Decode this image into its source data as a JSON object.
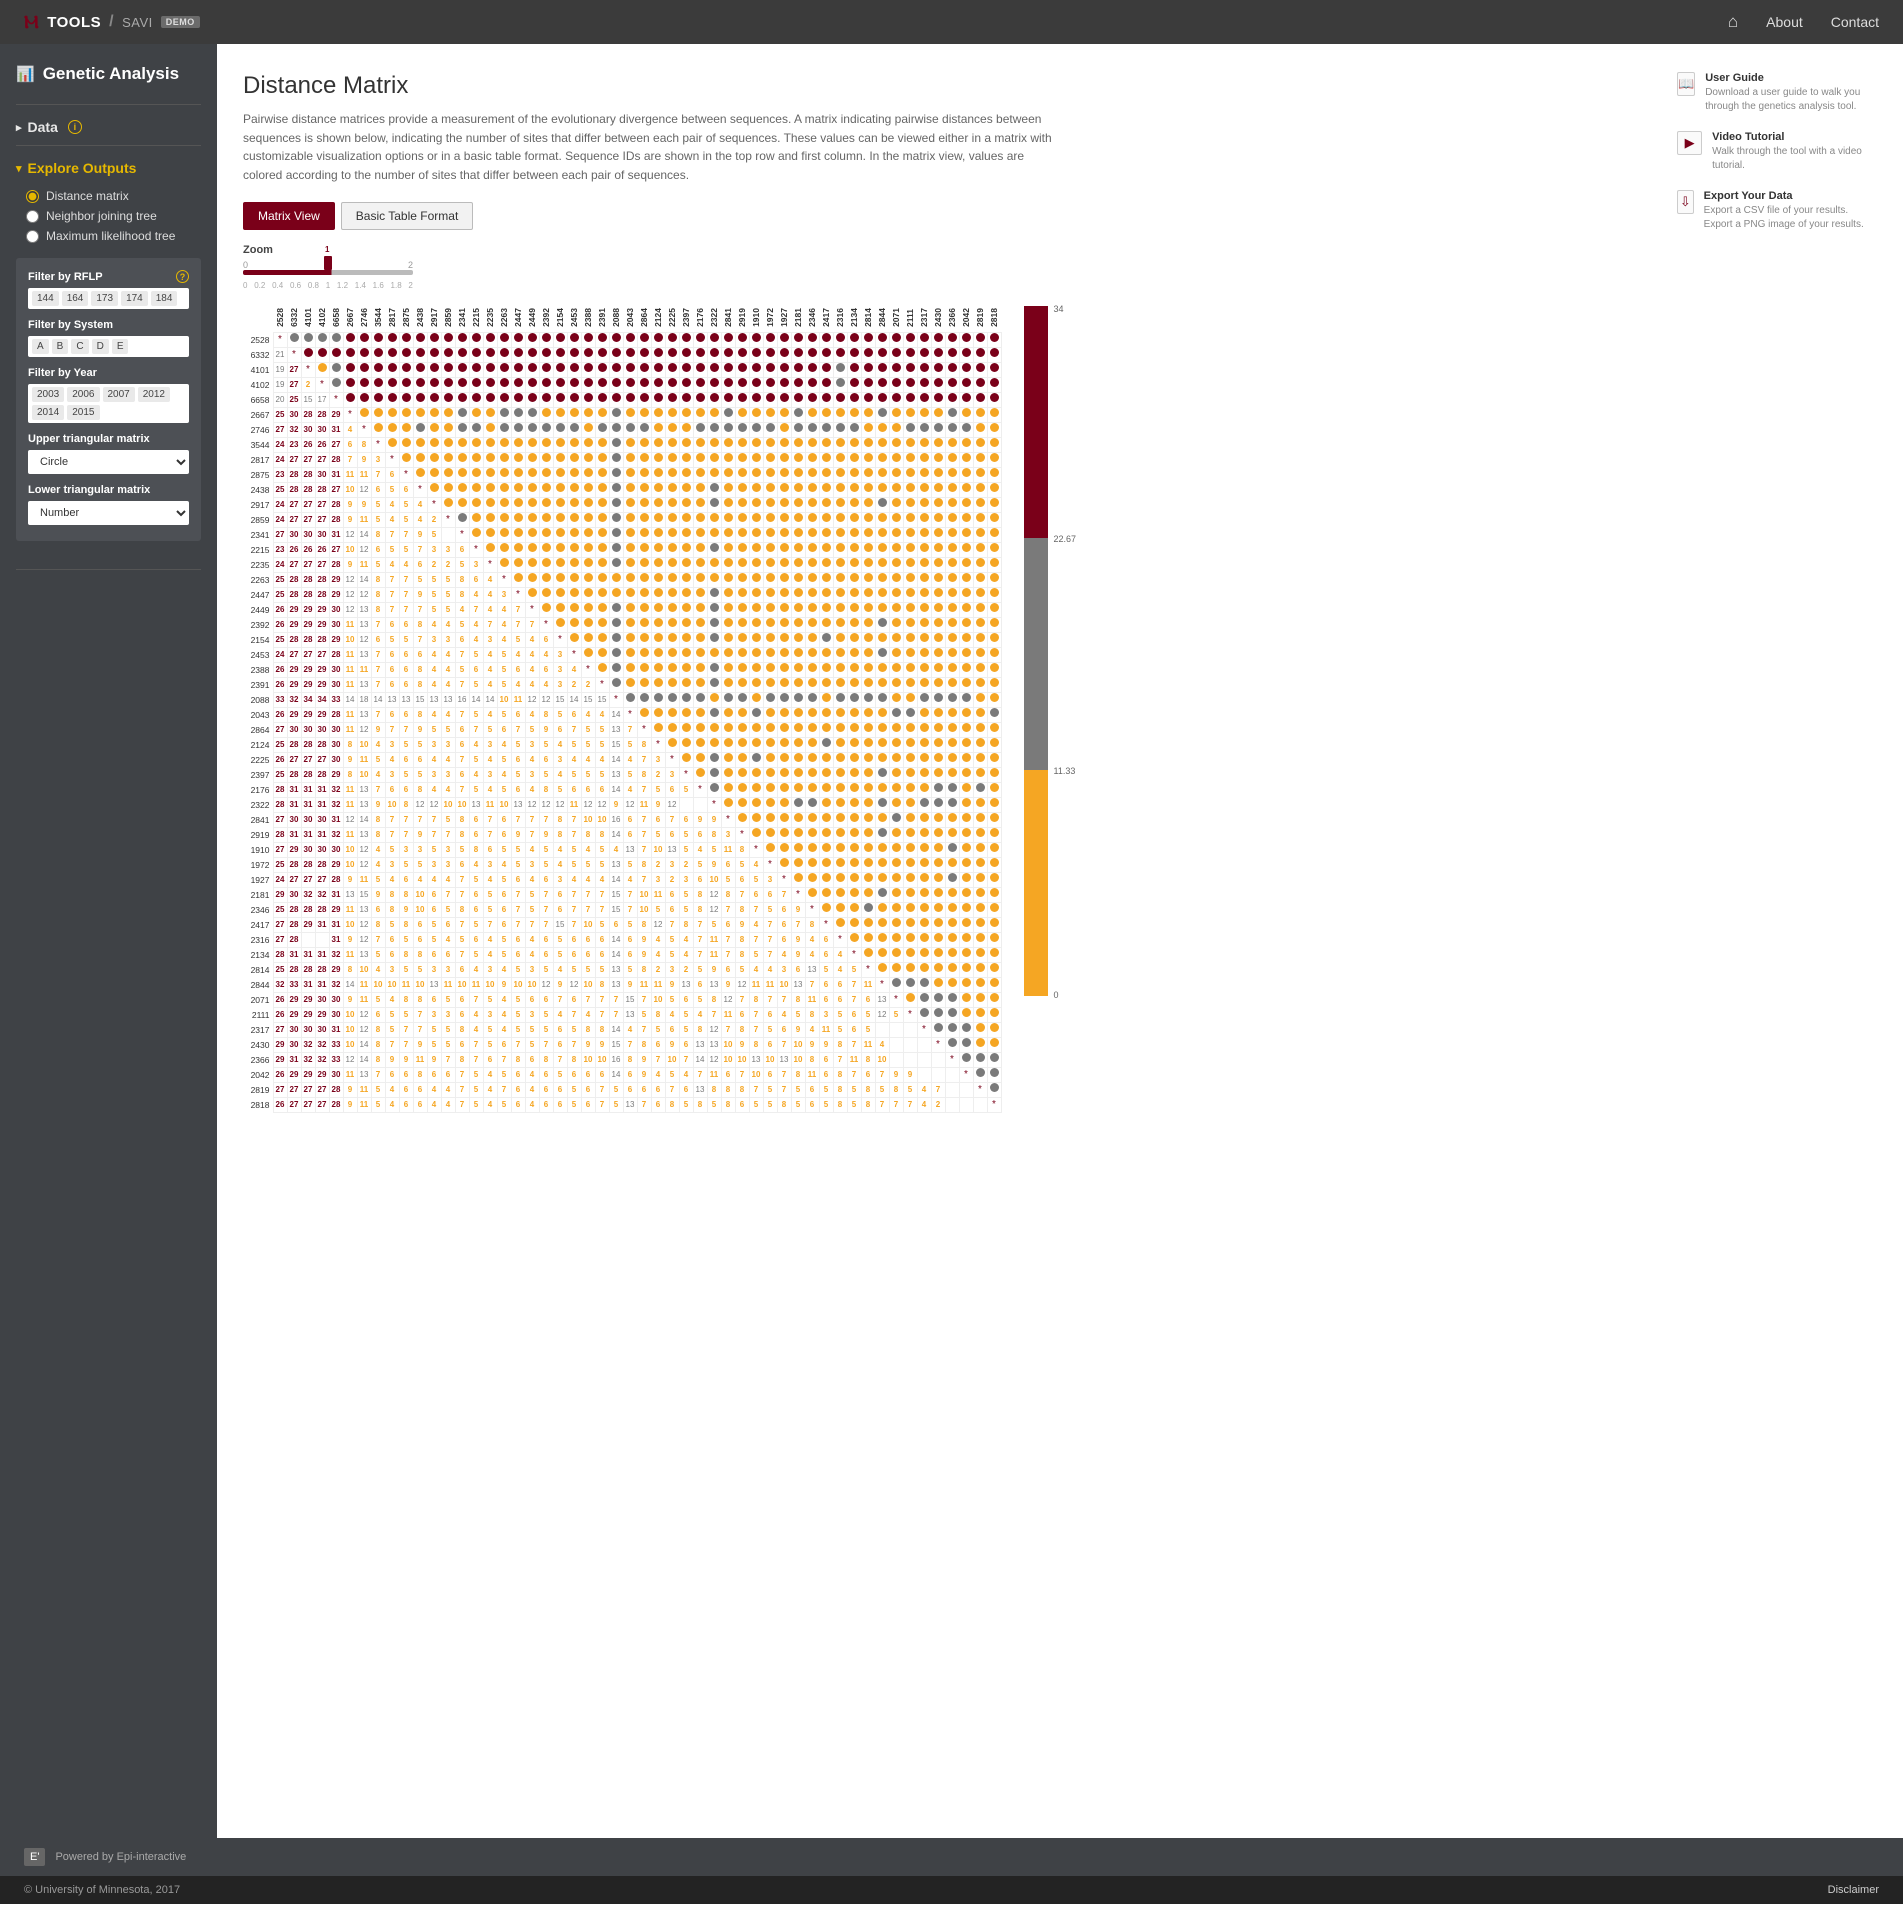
{
  "brand": {
    "tools": "TOOLS",
    "app": "SAVI",
    "badge": "DEMO"
  },
  "nav": {
    "about": "About",
    "contact": "Contact"
  },
  "sidebar": {
    "title": "Genetic Analysis",
    "data_label": "Data",
    "explore_label": "Explore Outputs",
    "items": [
      {
        "label": "Distance matrix",
        "checked": true
      },
      {
        "label": "Neighbor joining tree",
        "checked": false
      },
      {
        "label": "Maximum likelihood tree",
        "checked": false
      }
    ],
    "filters": {
      "rflp_label": "Filter by RFLP",
      "rflp_chips": [
        "144",
        "164",
        "173",
        "174",
        "184"
      ],
      "system_label": "Filter by System",
      "system_chips": [
        "A",
        "B",
        "C",
        "D",
        "E"
      ],
      "year_label": "Filter by Year",
      "year_chips": [
        "2003",
        "2006",
        "2007",
        "2012",
        "2014",
        "2015"
      ],
      "upper_label": "Upper triangular matrix",
      "upper_value": "Circle",
      "lower_label": "Lower triangular matrix",
      "lower_value": "Number"
    }
  },
  "page": {
    "title": "Distance Matrix",
    "intro": "Pairwise distance matrices provide a measurement of the evolutionary divergence between sequences. A matrix indicating pairwise distances between sequences is shown below, indicating the number of sites that differ between each pair of sequences. These values can be viewed either in a matrix with customizable visualization options or in a basic table format. Sequence IDs are shown in the top row and first column. In the matrix view, values are colored according to the number of sites that differ between each pair of sequences.",
    "tabs": [
      "Matrix View",
      "Basic Table Format"
    ],
    "zoom_label": "Zoom",
    "zoom_ends": [
      "0",
      "2"
    ],
    "zoom_scale": [
      "0",
      "0.2",
      "0.4",
      "0.6",
      "0.8",
      "1",
      "1.2",
      "1.4",
      "1.6",
      "1.8",
      "2"
    ],
    "zoom_value": "1"
  },
  "help": [
    {
      "icon": "📖",
      "title": "User Guide",
      "desc": "Download a user guide to walk you through the genetics analysis tool."
    },
    {
      "icon": "▶",
      "title": "Video Tutorial",
      "desc": "Walk through the tool with a video tutorial."
    },
    {
      "icon": "⇩",
      "title": "Export Your Data",
      "desc": "Export a CSV file of your results. Export a PNG image of your results."
    }
  ],
  "legend": {
    "ticks": [
      "34",
      "22.67",
      "11.33",
      "0"
    ]
  },
  "footer": {
    "powered": "Powered by Epi-interactive",
    "copy": "© University of Minnesota, 2017",
    "disc": "Disclaimer"
  },
  "chart_data": {
    "type": "heatmap",
    "title": "Distance Matrix",
    "ids": [
      "2528",
      "6332",
      "4101",
      "4102",
      "6658",
      "2667",
      "2746",
      "3544",
      "2817",
      "2875",
      "2438",
      "2917",
      "2859",
      "2341",
      "2215",
      "2235",
      "2263",
      "2447",
      "2449",
      "2392",
      "2154",
      "2453",
      "2388",
      "2391",
      "2088",
      "2043",
      "2864",
      "2124",
      "2225",
      "2397",
      "2176",
      "2322",
      "2841",
      "2919",
      "1910",
      "1972",
      "1927",
      "2181",
      "2346",
      "2417",
      "2316",
      "2134",
      "2814",
      "2844",
      "2071",
      "2111",
      "2317",
      "2430",
      "2366",
      "2042",
      "2819",
      "2818"
    ],
    "upper_viz": "circle",
    "lower_viz": "number",
    "legend_breaks": [
      0,
      11.33,
      22.67,
      34
    ],
    "colors": {
      "high": "#7a0019",
      "mid": "#7a7a7a",
      "low": "#f5a623"
    },
    "lower_rows": [
      [],
      [
        21
      ],
      [
        19,
        27
      ],
      [
        19,
        27,
        2
      ],
      [
        20,
        25,
        15,
        17
      ],
      [
        25,
        30,
        28,
        28,
        29
      ],
      [
        27,
        32,
        30,
        30,
        31,
        4
      ],
      [
        24,
        23,
        26,
        26,
        27,
        6,
        8
      ],
      [
        24,
        27,
        27,
        27,
        28,
        7,
        9,
        3
      ],
      [
        23,
        28,
        28,
        30,
        31,
        11,
        11,
        7,
        6
      ],
      [
        25,
        28,
        28,
        28,
        27,
        10,
        12,
        6,
        5,
        6
      ],
      [
        24,
        27,
        27,
        27,
        28,
        9,
        9,
        5,
        4,
        5,
        4
      ],
      [
        24,
        27,
        27,
        27,
        28,
        9,
        11,
        5,
        4,
        5,
        4,
        2
      ],
      [
        27,
        30,
        30,
        30,
        31,
        12,
        14,
        8,
        7,
        7,
        9,
        5
      ],
      [
        23,
        26,
        26,
        26,
        27,
        10,
        12,
        6,
        5,
        5,
        7,
        3,
        3,
        6
      ],
      [
        24,
        27,
        27,
        27,
        28,
        9,
        11,
        5,
        4,
        4,
        6,
        2,
        2,
        5,
        3
      ],
      [
        25,
        28,
        28,
        28,
        29,
        12,
        14,
        8,
        7,
        7,
        5,
        5,
        5,
        8,
        6,
        4
      ],
      [
        25,
        28,
        28,
        28,
        29,
        12,
        12,
        8,
        7,
        7,
        9,
        5,
        5,
        8,
        4,
        4,
        3
      ],
      [
        26,
        29,
        29,
        29,
        30,
        12,
        13,
        8,
        7,
        7,
        7,
        5,
        5,
        4,
        7,
        4,
        4,
        7
      ],
      [
        26,
        29,
        29,
        29,
        30,
        11,
        13,
        7,
        6,
        6,
        8,
        4,
        4,
        5,
        4,
        7,
        4,
        7,
        7
      ],
      [
        25,
        28,
        28,
        28,
        29,
        10,
        12,
        6,
        5,
        5,
        7,
        3,
        3,
        6,
        4,
        3,
        4,
        5,
        4,
        6
      ],
      [
        24,
        27,
        27,
        27,
        28,
        11,
        13,
        7,
        6,
        6,
        6,
        4,
        4,
        7,
        5,
        4,
        5,
        4,
        4,
        4,
        3
      ],
      [
        26,
        29,
        29,
        29,
        30,
        11,
        11,
        7,
        6,
        6,
        8,
        4,
        4,
        5,
        6,
        4,
        5,
        6,
        4,
        6,
        3,
        4
      ],
      [
        26,
        29,
        29,
        29,
        30,
        11,
        13,
        7,
        6,
        6,
        8,
        4,
        4,
        7,
        5,
        4,
        5,
        4,
        4,
        4,
        3,
        2,
        2
      ],
      [
        33,
        32,
        34,
        34,
        33,
        14,
        18,
        14,
        13,
        13,
        15,
        13,
        13,
        16,
        14,
        14,
        10,
        11,
        12,
        12,
        15,
        14,
        15,
        15,
        15
      ],
      [
        26,
        29,
        29,
        29,
        28,
        11,
        13,
        7,
        6,
        6,
        8,
        4,
        4,
        7,
        5,
        4,
        5,
        6,
        4,
        8,
        5,
        6,
        4,
        4,
        14
      ],
      [
        27,
        30,
        30,
        30,
        30,
        11,
        12,
        9,
        7,
        7,
        9,
        5,
        5,
        6,
        7,
        5,
        6,
        7,
        5,
        9,
        6,
        7,
        5,
        5,
        13,
        7
      ],
      [
        25,
        28,
        28,
        28,
        30,
        8,
        10,
        4,
        3,
        5,
        5,
        3,
        3,
        6,
        4,
        3,
        4,
        5,
        3,
        5,
        4,
        5,
        5,
        5,
        15,
        5,
        8
      ],
      [
        26,
        27,
        27,
        27,
        30,
        9,
        11,
        5,
        4,
        6,
        6,
        4,
        4,
        7,
        5,
        4,
        5,
        6,
        4,
        6,
        3,
        4,
        4,
        4,
        14,
        4,
        7,
        3
      ],
      [
        25,
        28,
        28,
        28,
        29,
        8,
        10,
        4,
        3,
        5,
        5,
        3,
        3,
        6,
        4,
        3,
        4,
        5,
        3,
        5,
        4,
        5,
        5,
        5,
        13,
        5,
        8,
        2,
        3
      ],
      [
        28,
        31,
        31,
        31,
        32,
        11,
        13,
        7,
        6,
        6,
        8,
        4,
        4,
        7,
        5,
        4,
        5,
        6,
        4,
        8,
        5,
        6,
        6,
        6,
        14,
        4,
        7,
        5,
        6,
        5
      ],
      [
        28,
        31,
        31,
        31,
        32,
        11,
        13,
        9,
        10,
        8,
        12,
        12,
        10,
        10,
        13,
        11,
        10,
        13,
        12,
        12,
        12,
        11,
        12,
        12,
        9,
        12,
        11,
        9,
        12
      ],
      [
        27,
        30,
        30,
        30,
        31,
        12,
        14,
        8,
        7,
        7,
        7,
        7,
        5,
        8,
        6,
        7,
        6,
        7,
        7,
        7,
        8,
        7,
        10,
        10,
        16,
        6,
        7,
        6,
        7,
        6,
        9,
        9
      ],
      [
        28,
        31,
        31,
        31,
        32,
        11,
        13,
        8,
        7,
        7,
        9,
        7,
        7,
        8,
        6,
        7,
        6,
        9,
        7,
        9,
        8,
        7,
        8,
        8,
        14,
        6,
        7,
        5,
        6,
        5,
        6,
        8,
        3
      ],
      [
        27,
        29,
        30,
        30,
        30,
        10,
        12,
        4,
        5,
        3,
        3,
        5,
        3,
        5,
        8,
        6,
        5,
        5,
        4,
        5,
        4,
        5,
        4,
        5,
        4,
        13,
        7,
        10,
        13,
        5,
        4,
        5,
        11,
        8,
        9
      ],
      [
        25,
        28,
        28,
        28,
        29,
        10,
        12,
        4,
        3,
        5,
        5,
        3,
        3,
        6,
        4,
        3,
        4,
        5,
        3,
        5,
        4,
        5,
        5,
        5,
        13,
        5,
        8,
        2,
        3,
        2,
        5,
        9,
        6,
        5,
        4
      ],
      [
        24,
        27,
        27,
        27,
        28,
        9,
        11,
        5,
        4,
        6,
        4,
        4,
        4,
        7,
        5,
        4,
        5,
        6,
        4,
        6,
        3,
        4,
        4,
        4,
        14,
        4,
        7,
        3,
        2,
        3,
        6,
        10,
        5,
        6,
        5,
        3
      ],
      [
        29,
        30,
        32,
        32,
        31,
        13,
        15,
        9,
        8,
        8,
        10,
        6,
        7,
        7,
        6,
        5,
        6,
        7,
        5,
        7,
        6,
        7,
        7,
        7,
        15,
        7,
        10,
        11,
        6,
        5,
        8,
        12,
        8,
        7,
        6,
        6,
        7
      ],
      [
        25,
        28,
        28,
        28,
        29,
        11,
        13,
        6,
        8,
        9,
        10,
        6,
        5,
        8,
        6,
        5,
        6,
        7,
        5,
        7,
        6,
        7,
        7,
        7,
        15,
        7,
        10,
        5,
        6,
        5,
        8,
        12,
        7,
        8,
        7,
        5,
        6,
        9
      ],
      [
        27,
        28,
        29,
        31,
        31,
        10,
        12,
        8,
        5,
        8,
        6,
        5,
        6,
        7,
        5,
        7,
        6,
        7,
        7,
        7,
        15,
        7,
        10,
        5,
        6,
        5,
        8,
        12,
        7,
        8,
        7,
        5,
        6,
        9,
        4,
        7,
        6,
        7,
        8
      ],
      [
        27,
        28,
        "",
        "",
        31,
        9,
        12,
        7,
        6,
        5,
        6,
        5,
        4,
        5,
        6,
        4,
        5,
        6,
        4,
        6,
        5,
        6,
        6,
        6,
        14,
        6,
        9,
        4,
        5,
        4,
        7,
        11,
        7,
        8,
        7,
        7,
        6,
        9,
        4,
        6
      ],
      [
        28,
        31,
        31,
        31,
        32,
        11,
        13,
        5,
        6,
        8,
        8,
        6,
        6,
        7,
        5,
        4,
        5,
        6,
        4,
        6,
        5,
        6,
        6,
        6,
        14,
        6,
        9,
        4,
        5,
        4,
        7,
        11,
        7,
        8,
        5,
        7,
        4,
        9,
        4,
        6,
        4
      ],
      [
        25,
        28,
        28,
        28,
        29,
        8,
        10,
        4,
        3,
        5,
        5,
        3,
        3,
        6,
        4,
        3,
        4,
        5,
        3,
        5,
        4,
        5,
        5,
        5,
        13,
        5,
        8,
        2,
        3,
        2,
        5,
        9,
        6,
        5,
        4,
        4,
        3,
        6,
        13,
        5,
        4,
        5
      ],
      [
        32,
        33,
        31,
        31,
        32,
        14,
        11,
        10,
        10,
        11,
        10,
        13,
        11,
        10,
        11,
        10,
        9,
        10,
        10,
        12,
        9,
        12,
        10,
        8,
        13,
        9,
        11,
        11,
        9,
        13,
        6,
        13,
        9,
        12,
        11,
        11,
        10,
        13,
        7,
        6,
        6,
        7,
        11
      ],
      [
        26,
        29,
        29,
        30,
        30,
        9,
        11,
        5,
        4,
        8,
        8,
        6,
        5,
        6,
        7,
        5,
        4,
        5,
        6,
        6,
        7,
        6,
        7,
        7,
        7,
        15,
        7,
        10,
        5,
        6,
        5,
        8,
        12,
        7,
        8,
        7,
        7,
        8,
        11,
        6,
        6,
        7,
        6,
        13
      ],
      [
        26,
        29,
        29,
        29,
        30,
        10,
        12,
        6,
        5,
        5,
        7,
        3,
        3,
        6,
        4,
        3,
        4,
        5,
        3,
        5,
        4,
        7,
        4,
        7,
        7,
        13,
        5,
        8,
        4,
        5,
        4,
        7,
        11,
        6,
        7,
        6,
        4,
        5,
        8,
        3,
        5,
        6,
        5,
        12,
        5
      ],
      [
        27,
        30,
        30,
        30,
        31,
        10,
        12,
        8,
        5,
        7,
        7,
        5,
        5,
        8,
        4,
        5,
        4,
        5,
        5,
        5,
        6,
        5,
        8,
        8,
        14,
        4,
        7,
        5,
        6,
        5,
        8,
        12,
        7,
        8,
        7,
        5,
        6,
        9,
        4,
        11,
        5,
        6,
        5
      ],
      [
        29,
        30,
        32,
        32,
        33,
        10,
        14,
        8,
        7,
        7,
        9,
        5,
        5,
        6,
        7,
        5,
        6,
        7,
        5,
        7,
        6,
        7,
        9,
        9,
        15,
        7,
        8,
        6,
        9,
        6,
        13,
        13,
        10,
        9,
        8,
        6,
        7,
        10,
        9,
        9,
        8,
        7,
        11,
        4
      ],
      [
        29,
        31,
        32,
        32,
        33,
        12,
        14,
        8,
        9,
        9,
        11,
        9,
        7,
        8,
        7,
        6,
        7,
        8,
        6,
        8,
        7,
        8,
        10,
        10,
        16,
        8,
        9,
        7,
        10,
        7,
        14,
        12,
        10,
        10,
        13,
        10,
        13,
        10,
        8,
        6,
        7,
        11,
        8,
        10
      ],
      [
        26,
        29,
        29,
        29,
        30,
        11,
        13,
        7,
        6,
        6,
        8,
        6,
        6,
        7,
        5,
        4,
        5,
        6,
        4,
        6,
        5,
        6,
        6,
        6,
        14,
        6,
        9,
        4,
        5,
        4,
        7,
        11,
        6,
        7,
        10,
        6,
        7,
        8,
        11,
        6,
        8,
        7,
        6,
        7,
        9,
        9
      ],
      [
        27,
        27,
        27,
        27,
        28,
        9,
        11,
        5,
        4,
        6,
        6,
        4,
        4,
        7,
        5,
        4,
        7,
        6,
        4,
        6,
        6,
        5,
        6,
        7,
        5,
        6,
        6,
        6,
        7,
        6,
        13,
        8,
        8,
        8,
        7,
        5,
        7,
        5,
        6,
        5,
        8,
        5,
        8,
        5,
        8,
        5,
        4,
        7
      ],
      [
        26,
        27,
        27,
        27,
        28,
        9,
        11,
        5,
        4,
        6,
        6,
        4,
        4,
        7,
        5,
        4,
        5,
        6,
        4,
        6,
        6,
        5,
        6,
        7,
        5,
        13,
        7,
        6,
        8,
        5,
        8,
        5,
        8,
        6,
        5,
        5,
        8,
        5,
        6,
        5,
        8,
        5,
        8,
        7,
        7,
        7,
        4,
        2
      ]
    ]
  }
}
